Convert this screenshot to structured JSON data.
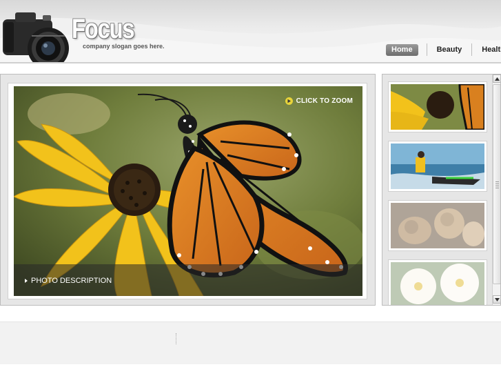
{
  "brand": {
    "title": "Focus",
    "slogan": "company slogan goes here."
  },
  "nav": {
    "items": [
      {
        "label": "Home",
        "active": true
      },
      {
        "label": "Beauty",
        "active": false
      },
      {
        "label": "Health",
        "active": false
      }
    ]
  },
  "viewer": {
    "zoom_label": "CLICK TO ZOOM",
    "description": "PHOTO DESCRIPTION"
  },
  "thumbnails": [
    {
      "subject": "butterfly-on-flower",
      "faded": false
    },
    {
      "subject": "jet-ski-rider",
      "faded": false
    },
    {
      "subject": "lions",
      "faded": true
    },
    {
      "subject": "white-flowers",
      "faded": true
    }
  ],
  "icons": {
    "camera": "camera-logo-icon",
    "zoom": "zoom-icon",
    "play": "triangle-right-icon",
    "scroll_up": "chevron-up-icon",
    "scroll_down": "chevron-down-icon"
  },
  "colors": {
    "nav_active_bg": "#7a7a7a",
    "zoom_icon": "#e8d43a",
    "panel_bg": "#e6e6e6"
  }
}
